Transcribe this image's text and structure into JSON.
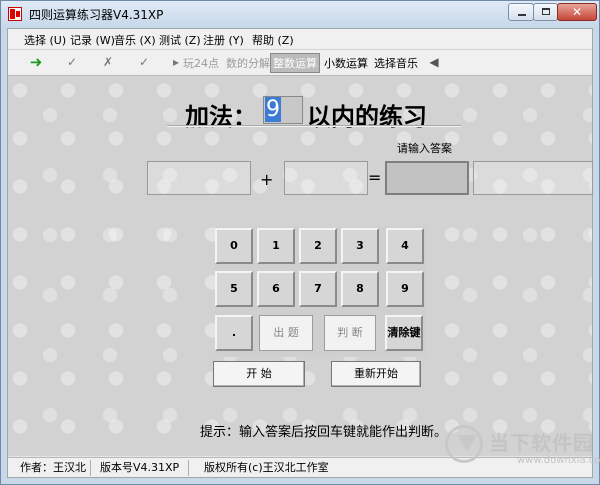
{
  "window": {
    "title": "四则运算练习器V4.31XP",
    "close_glyph": "✕"
  },
  "menu": [
    {
      "label": "选择 (U)"
    },
    {
      "label": "记录 (W)"
    },
    {
      "label": "音乐 (X)"
    },
    {
      "label": "测试 (Z)"
    },
    {
      "label": "注册 (Y)"
    },
    {
      "label": "帮助 (Z)"
    }
  ],
  "toolbar": {
    "icons": [
      {
        "name": "run-arrow-icon",
        "glyph": "➜"
      },
      {
        "name": "check-icon",
        "glyph": "✓"
      },
      {
        "name": "cross-icon",
        "glyph": "✗"
      },
      {
        "name": "check-plus-icon",
        "glyph": "✓"
      },
      {
        "name": "play-icon",
        "glyph": "▸"
      }
    ],
    "play24": "玩24点",
    "factor": "数的分解",
    "integer": "整数运算",
    "decimal": "小数运算",
    "music": "选择音乐",
    "speaker_glyph": "◀"
  },
  "exercise": {
    "operation": "加法：",
    "range": "9",
    "suffix": "以内的练习",
    "answer_hint": "请输入答案",
    "plus": "+",
    "equals": "="
  },
  "keypad": {
    "row1": [
      "0",
      "1",
      "2",
      "3",
      "4"
    ],
    "row2": [
      "5",
      "6",
      "7",
      "8",
      "9"
    ],
    "dot": ".",
    "question": "出 题",
    "judge": "判 断",
    "clear": "清除键"
  },
  "buttons": {
    "start": "开 始",
    "restart": "重新开始"
  },
  "tip": "提示：输入答案后按回车键就能作出判断。",
  "status": {
    "author": "作者：王汉北",
    "version": "版本号V4.31XP",
    "copyright": "版权所有(c)王汉北工作室"
  },
  "watermark": {
    "brand": "当下软件园",
    "url": "www.downxia.com"
  }
}
